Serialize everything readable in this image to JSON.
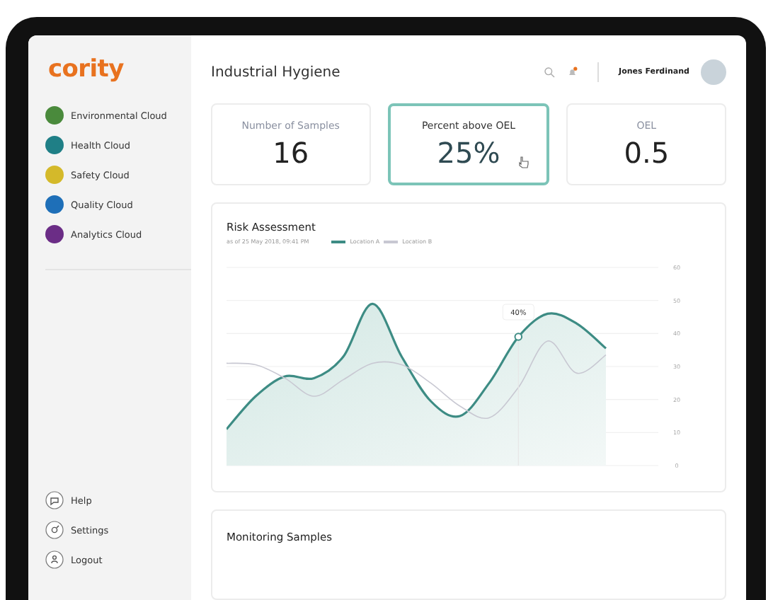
{
  "sidebar": {
    "logo": "cority",
    "items": [
      {
        "label": "Environmental Cloud",
        "color": "#4a8a3c"
      },
      {
        "label": "Health Cloud",
        "color": "#1f7f86"
      },
      {
        "label": "Safety Cloud",
        "color": "#d4b92a"
      },
      {
        "label": "Quality Cloud",
        "color": "#1e6fb8"
      },
      {
        "label": "Analytics Cloud",
        "color": "#6b2d86"
      }
    ],
    "bottom_items": [
      {
        "label": "Help",
        "kind": "help"
      },
      {
        "label": "Settings",
        "kind": "settings"
      },
      {
        "label": "Logout",
        "kind": "logout"
      }
    ]
  },
  "header": {
    "title": "Industrial Hygiene",
    "notification": true,
    "user": "Jones Ferdinand"
  },
  "stats": [
    {
      "label": "Number of Samples",
      "value": "16",
      "selected": false
    },
    {
      "label": "Percent above OEL",
      "value": "25%",
      "selected": true
    },
    {
      "label": "OEL",
      "value": "0.5",
      "selected": false
    }
  ],
  "risk": {
    "title": "Risk Assessment",
    "subtitle": "as of 25 May 2018, 09:41 PM",
    "tooltip": "40%",
    "chart_data": {
      "type": "area",
      "grid": true,
      "series": [
        {
          "name": "Location A",
          "type": "area",
          "color": "#3d8c84",
          "values": [
            11,
            21,
            27,
            26.5,
            33,
            49,
            33,
            19.5,
            15,
            25,
            39,
            46,
            43,
            35.5
          ]
        },
        {
          "name": "Location B",
          "type": "line",
          "color": "#c8c8d2",
          "values": [
            31,
            30.5,
            26.5,
            21,
            26,
            31,
            30.5,
            25,
            18,
            14.5,
            23.7,
            37.7,
            28,
            33.5
          ]
        }
      ],
      "ylim": [
        0,
        60
      ],
      "yticks": [
        0,
        10,
        20,
        30,
        40,
        50,
        60
      ]
    }
  },
  "monitoring": {
    "title": "Monitoring Samples"
  }
}
